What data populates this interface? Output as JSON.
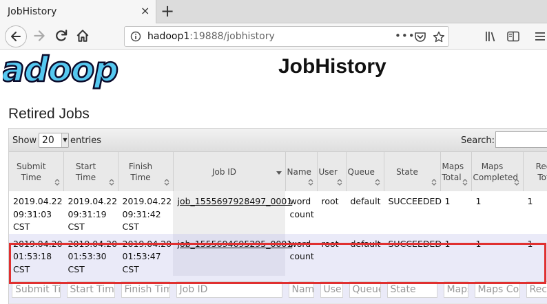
{
  "browser": {
    "tab_title": "JobHistory",
    "tab_close": "×",
    "new_tab": "+",
    "url_host": "hadoop1",
    "url_rest": ":19888/jobhistory",
    "url_dots": "•••"
  },
  "page": {
    "title": "JobHistory",
    "section_title": "Retired Jobs"
  },
  "controls": {
    "show_label": "Show",
    "entries_value": "20",
    "entries_arrow": "▼",
    "entries_label": "entries",
    "search_label": "Search:"
  },
  "table": {
    "headers": [
      "Submit\nTime",
      "Start Time",
      "Finish Time",
      "Job ID",
      "Name",
      "User",
      "Queue",
      "State",
      "Maps\nTotal",
      "Maps\nCompleted",
      "Red\nTot"
    ],
    "rows": [
      {
        "submit": "2019.04.22\n09:31:03\nCST",
        "start": "2019.04.22\n09:31:19\nCST",
        "finish": "2019.04.22\n09:31:42\nCST",
        "job_id": "job_1555697928497_0001",
        "name": "word\ncount",
        "user": "root",
        "queue": "default",
        "state": "SUCCEEDED",
        "maps_total": "1",
        "maps_completed": "1",
        "reduces_total": "1"
      },
      {
        "submit": "2019.04.20\n01:53:18\nCST",
        "start": "2019.04.20\n01:53:30\nCST",
        "finish": "2019.04.20\n01:53:47\nCST",
        "job_id": "job_1555694695295_0001",
        "name": "word\ncount",
        "user": "root",
        "queue": "default",
        "state": "SUCCEEDED",
        "maps_total": "1",
        "maps_completed": "1",
        "reduces_total": "1"
      }
    ],
    "filters": [
      "Submit Tir",
      "Start Time",
      "Finish Tim",
      "Job ID",
      "Nam",
      "Use",
      "Queue",
      "State",
      "Maps",
      "Maps Con",
      "Rec"
    ]
  },
  "colors": {
    "highlight": "#e03030",
    "logo_blue": "#55c8f0"
  },
  "icons": [
    "back-icon",
    "forward-icon",
    "reload-icon",
    "home-icon",
    "info-icon",
    "pocket-icon",
    "bookmark-star-icon",
    "library-icon",
    "sidebar-icon",
    "menu-icon",
    "sort-icon"
  ]
}
